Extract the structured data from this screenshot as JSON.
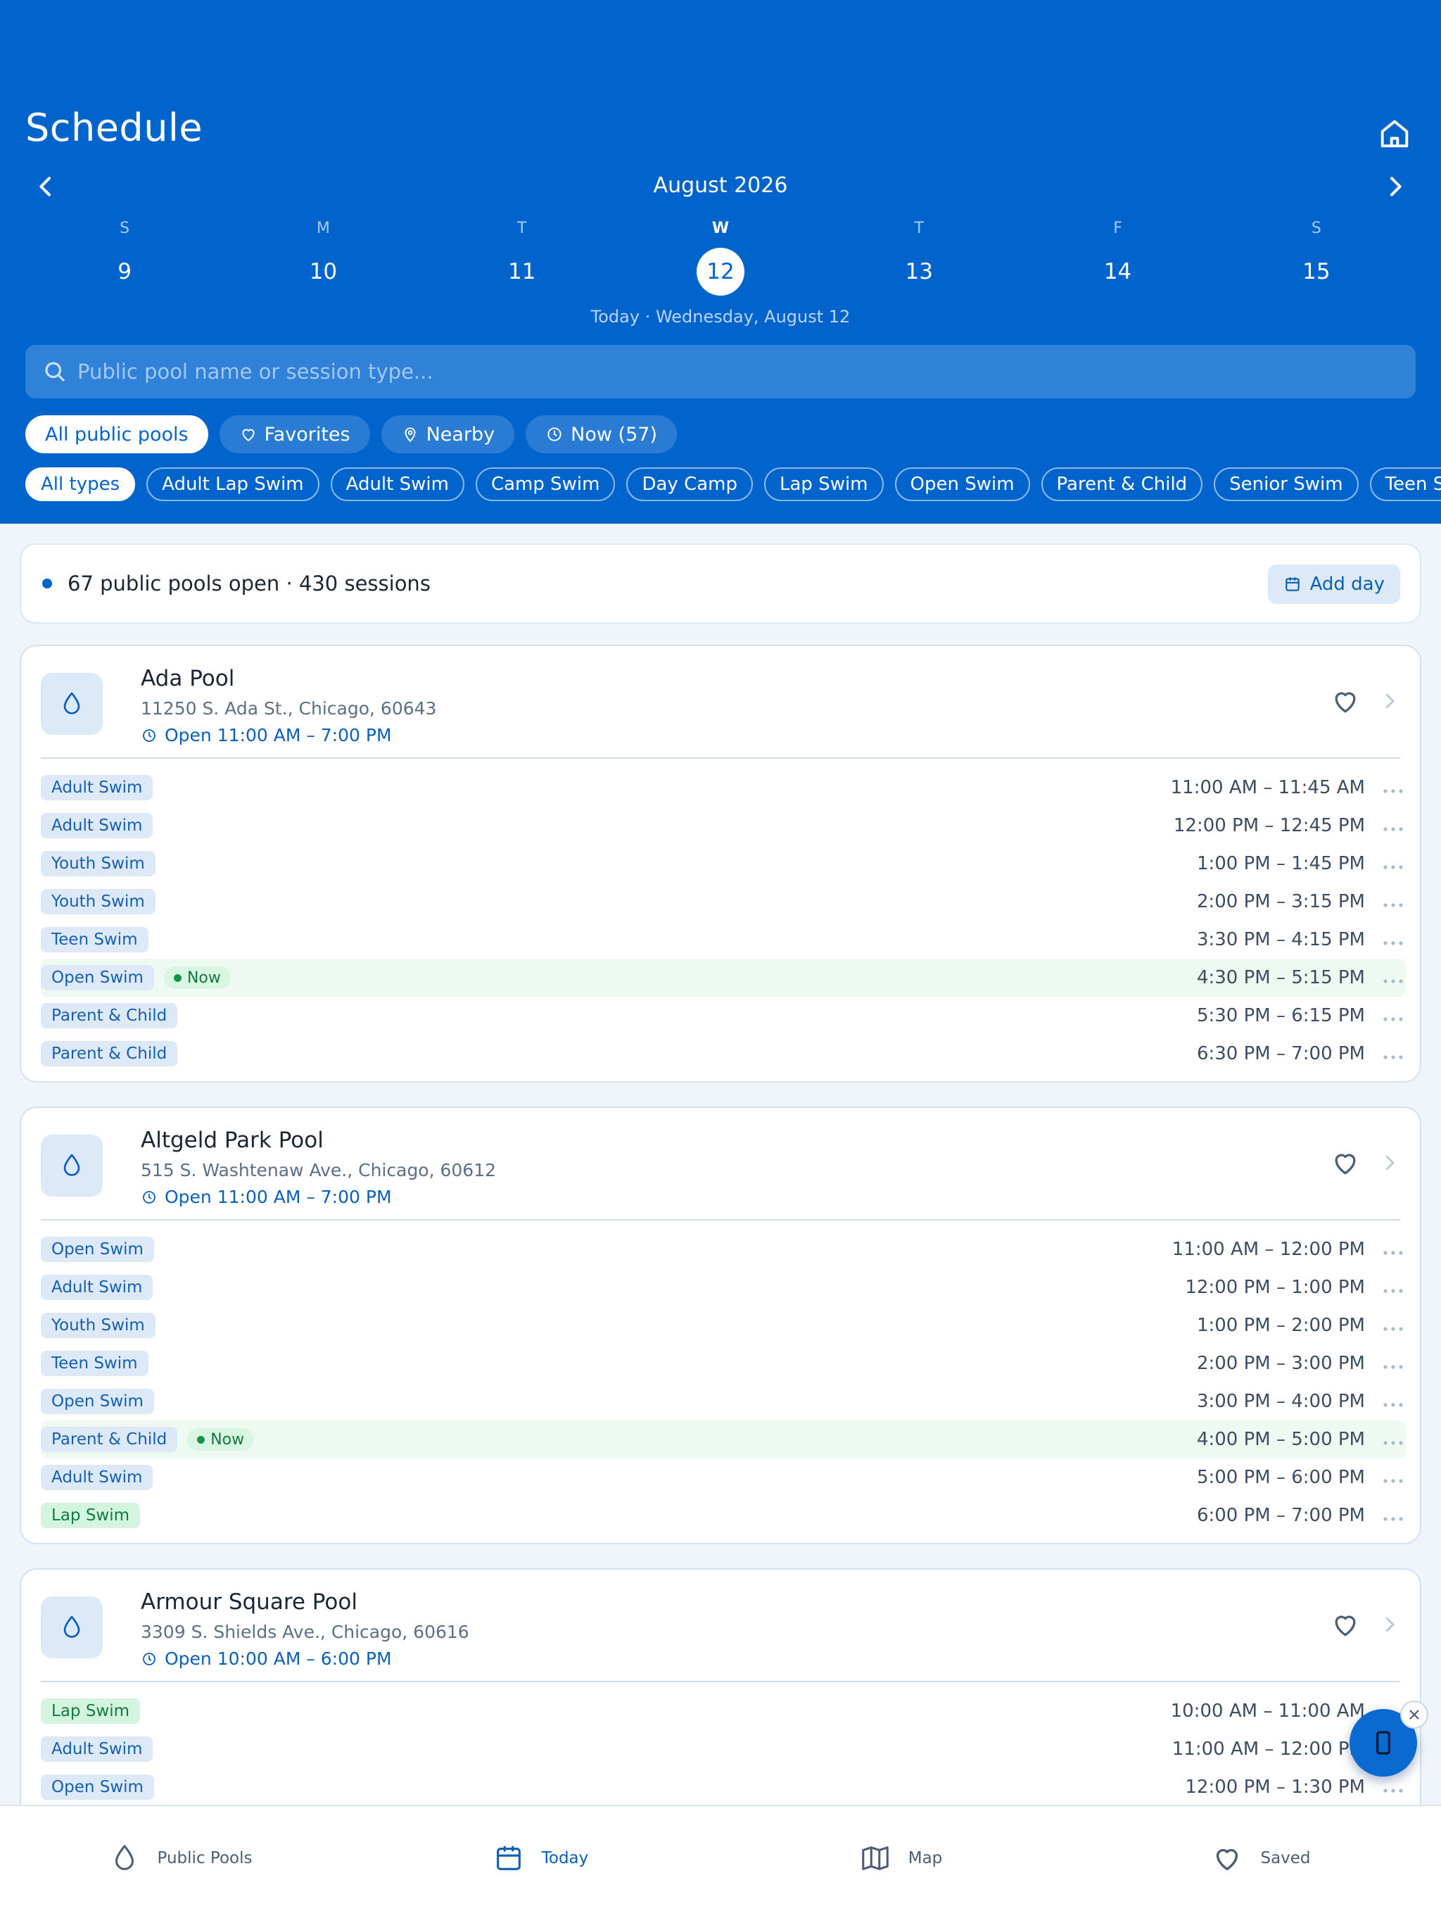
{
  "header": {
    "title": "Schedule",
    "month": "August 2026",
    "today_label": "Today · Wednesday, August 12",
    "days": [
      {
        "dow": "S",
        "num": "9"
      },
      {
        "dow": "M",
        "num": "10"
      },
      {
        "dow": "T",
        "num": "11"
      },
      {
        "dow": "W",
        "num": "12",
        "selected": true
      },
      {
        "dow": "T",
        "num": "13"
      },
      {
        "dow": "F",
        "num": "14"
      },
      {
        "dow": "S",
        "num": "15"
      }
    ]
  },
  "search": {
    "placeholder": "Public pool name or session type..."
  },
  "filters": [
    {
      "label": "All public pools",
      "active": true,
      "icon": ""
    },
    {
      "label": "Favorites",
      "icon": "heart-icon"
    },
    {
      "label": "Nearby",
      "icon": "location-pin-icon"
    },
    {
      "label": "Now (57)",
      "icon": "clock-icon"
    }
  ],
  "types": [
    "All types",
    "Adult Lap Swim",
    "Adult Swim",
    "Camp Swim",
    "Day Camp",
    "Lap Swim",
    "Open Swim",
    "Parent & Child",
    "Senior Swim",
    "Teen Swim",
    ""
  ],
  "summary": {
    "text": "67 public pools open · 430 sessions",
    "add_day": "Add day"
  },
  "now_label": "Now",
  "pools": [
    {
      "name": "Ada Pool",
      "address": "11250 S. Ada St., Chicago, 60643",
      "hours": "Open 11:00 AM – 7:00 PM",
      "sessions": [
        {
          "type": "Adult Swim",
          "time": "11:00 AM – 11:45 AM"
        },
        {
          "type": "Adult Swim",
          "time": "12:00 PM – 12:45 PM"
        },
        {
          "type": "Youth Swim",
          "time": "1:00 PM – 1:45 PM"
        },
        {
          "type": "Youth Swim",
          "time": "2:00 PM – 3:15 PM"
        },
        {
          "type": "Teen Swim",
          "time": "3:30 PM – 4:15 PM"
        },
        {
          "type": "Open Swim",
          "time": "4:30 PM – 5:15 PM",
          "now": true
        },
        {
          "type": "Parent & Child",
          "time": "5:30 PM – 6:15 PM"
        },
        {
          "type": "Parent & Child",
          "time": "6:30 PM – 7:00 PM"
        }
      ]
    },
    {
      "name": "Altgeld Park Pool",
      "address": "515 S. Washtenaw Ave., Chicago, 60612",
      "hours": "Open 11:00 AM – 7:00 PM",
      "sessions": [
        {
          "type": "Open Swim",
          "time": "11:00 AM – 12:00 PM"
        },
        {
          "type": "Adult Swim",
          "time": "12:00 PM – 1:00 PM"
        },
        {
          "type": "Youth Swim",
          "time": "1:00 PM – 2:00 PM"
        },
        {
          "type": "Teen Swim",
          "time": "2:00 PM – 3:00 PM"
        },
        {
          "type": "Open Swim",
          "time": "3:00 PM – 4:00 PM"
        },
        {
          "type": "Parent & Child",
          "time": "4:00 PM – 5:00 PM",
          "now": true
        },
        {
          "type": "Adult Swim",
          "time": "5:00 PM – 6:00 PM"
        },
        {
          "type": "Lap Swim",
          "time": "6:00 PM – 7:00 PM",
          "green": true
        }
      ]
    },
    {
      "name": "Armour Square Pool",
      "address": "3309 S. Shields Ave., Chicago, 60616",
      "hours": "Open 10:00 AM – 6:00 PM",
      "sessions": [
        {
          "type": "Lap Swim",
          "time": "10:00 AM – 11:00 AM",
          "green": true
        },
        {
          "type": "Adult Swim",
          "time": "11:00 AM – 12:00 PM"
        },
        {
          "type": "Open Swim",
          "time": "12:00 PM – 1:30 PM"
        },
        {
          "type": "",
          "time": ""
        }
      ]
    }
  ],
  "bottom_nav": [
    {
      "label": "Public Pools",
      "icon": "droplet-icon"
    },
    {
      "label": "Today",
      "icon": "calendar-icon",
      "active": true
    },
    {
      "label": "Map",
      "icon": "map-icon"
    },
    {
      "label": "Saved",
      "icon": "heart-icon"
    }
  ],
  "colors": {
    "brand": "#0064cc",
    "now_green": "#137a3f",
    "background": "#f0f5fb"
  }
}
